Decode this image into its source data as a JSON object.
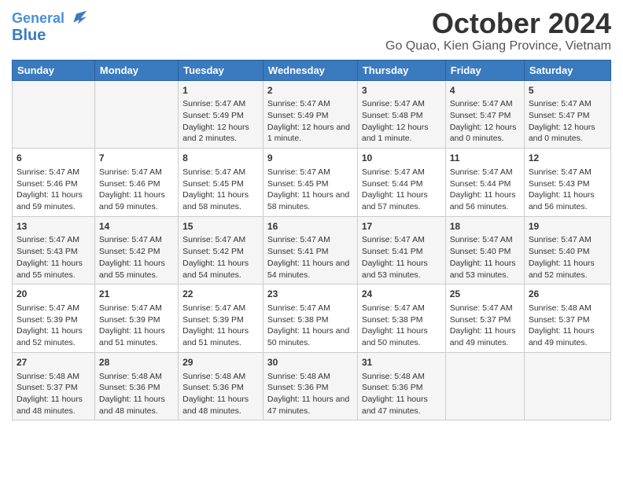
{
  "header": {
    "logo_line1": "General",
    "logo_line2": "Blue",
    "month": "October 2024",
    "location": "Go Quao, Kien Giang Province, Vietnam"
  },
  "days_of_week": [
    "Sunday",
    "Monday",
    "Tuesday",
    "Wednesday",
    "Thursday",
    "Friday",
    "Saturday"
  ],
  "weeks": [
    [
      {
        "day": "",
        "info": ""
      },
      {
        "day": "",
        "info": ""
      },
      {
        "day": "1",
        "info": "Sunrise: 5:47 AM\nSunset: 5:49 PM\nDaylight: 12 hours and 2 minutes."
      },
      {
        "day": "2",
        "info": "Sunrise: 5:47 AM\nSunset: 5:49 PM\nDaylight: 12 hours and 1 minute."
      },
      {
        "day": "3",
        "info": "Sunrise: 5:47 AM\nSunset: 5:48 PM\nDaylight: 12 hours and 1 minute."
      },
      {
        "day": "4",
        "info": "Sunrise: 5:47 AM\nSunset: 5:47 PM\nDaylight: 12 hours and 0 minutes."
      },
      {
        "day": "5",
        "info": "Sunrise: 5:47 AM\nSunset: 5:47 PM\nDaylight: 12 hours and 0 minutes."
      }
    ],
    [
      {
        "day": "6",
        "info": "Sunrise: 5:47 AM\nSunset: 5:46 PM\nDaylight: 11 hours and 59 minutes."
      },
      {
        "day": "7",
        "info": "Sunrise: 5:47 AM\nSunset: 5:46 PM\nDaylight: 11 hours and 59 minutes."
      },
      {
        "day": "8",
        "info": "Sunrise: 5:47 AM\nSunset: 5:45 PM\nDaylight: 11 hours and 58 minutes."
      },
      {
        "day": "9",
        "info": "Sunrise: 5:47 AM\nSunset: 5:45 PM\nDaylight: 11 hours and 58 minutes."
      },
      {
        "day": "10",
        "info": "Sunrise: 5:47 AM\nSunset: 5:44 PM\nDaylight: 11 hours and 57 minutes."
      },
      {
        "day": "11",
        "info": "Sunrise: 5:47 AM\nSunset: 5:44 PM\nDaylight: 11 hours and 56 minutes."
      },
      {
        "day": "12",
        "info": "Sunrise: 5:47 AM\nSunset: 5:43 PM\nDaylight: 11 hours and 56 minutes."
      }
    ],
    [
      {
        "day": "13",
        "info": "Sunrise: 5:47 AM\nSunset: 5:43 PM\nDaylight: 11 hours and 55 minutes."
      },
      {
        "day": "14",
        "info": "Sunrise: 5:47 AM\nSunset: 5:42 PM\nDaylight: 11 hours and 55 minutes."
      },
      {
        "day": "15",
        "info": "Sunrise: 5:47 AM\nSunset: 5:42 PM\nDaylight: 11 hours and 54 minutes."
      },
      {
        "day": "16",
        "info": "Sunrise: 5:47 AM\nSunset: 5:41 PM\nDaylight: 11 hours and 54 minutes."
      },
      {
        "day": "17",
        "info": "Sunrise: 5:47 AM\nSunset: 5:41 PM\nDaylight: 11 hours and 53 minutes."
      },
      {
        "day": "18",
        "info": "Sunrise: 5:47 AM\nSunset: 5:40 PM\nDaylight: 11 hours and 53 minutes."
      },
      {
        "day": "19",
        "info": "Sunrise: 5:47 AM\nSunset: 5:40 PM\nDaylight: 11 hours and 52 minutes."
      }
    ],
    [
      {
        "day": "20",
        "info": "Sunrise: 5:47 AM\nSunset: 5:39 PM\nDaylight: 11 hours and 52 minutes."
      },
      {
        "day": "21",
        "info": "Sunrise: 5:47 AM\nSunset: 5:39 PM\nDaylight: 11 hours and 51 minutes."
      },
      {
        "day": "22",
        "info": "Sunrise: 5:47 AM\nSunset: 5:39 PM\nDaylight: 11 hours and 51 minutes."
      },
      {
        "day": "23",
        "info": "Sunrise: 5:47 AM\nSunset: 5:38 PM\nDaylight: 11 hours and 50 minutes."
      },
      {
        "day": "24",
        "info": "Sunrise: 5:47 AM\nSunset: 5:38 PM\nDaylight: 11 hours and 50 minutes."
      },
      {
        "day": "25",
        "info": "Sunrise: 5:47 AM\nSunset: 5:37 PM\nDaylight: 11 hours and 49 minutes."
      },
      {
        "day": "26",
        "info": "Sunrise: 5:48 AM\nSunset: 5:37 PM\nDaylight: 11 hours and 49 minutes."
      }
    ],
    [
      {
        "day": "27",
        "info": "Sunrise: 5:48 AM\nSunset: 5:37 PM\nDaylight: 11 hours and 48 minutes."
      },
      {
        "day": "28",
        "info": "Sunrise: 5:48 AM\nSunset: 5:36 PM\nDaylight: 11 hours and 48 minutes."
      },
      {
        "day": "29",
        "info": "Sunrise: 5:48 AM\nSunset: 5:36 PM\nDaylight: 11 hours and 48 minutes."
      },
      {
        "day": "30",
        "info": "Sunrise: 5:48 AM\nSunset: 5:36 PM\nDaylight: 11 hours and 47 minutes."
      },
      {
        "day": "31",
        "info": "Sunrise: 5:48 AM\nSunset: 5:36 PM\nDaylight: 11 hours and 47 minutes."
      },
      {
        "day": "",
        "info": ""
      },
      {
        "day": "",
        "info": ""
      }
    ]
  ]
}
